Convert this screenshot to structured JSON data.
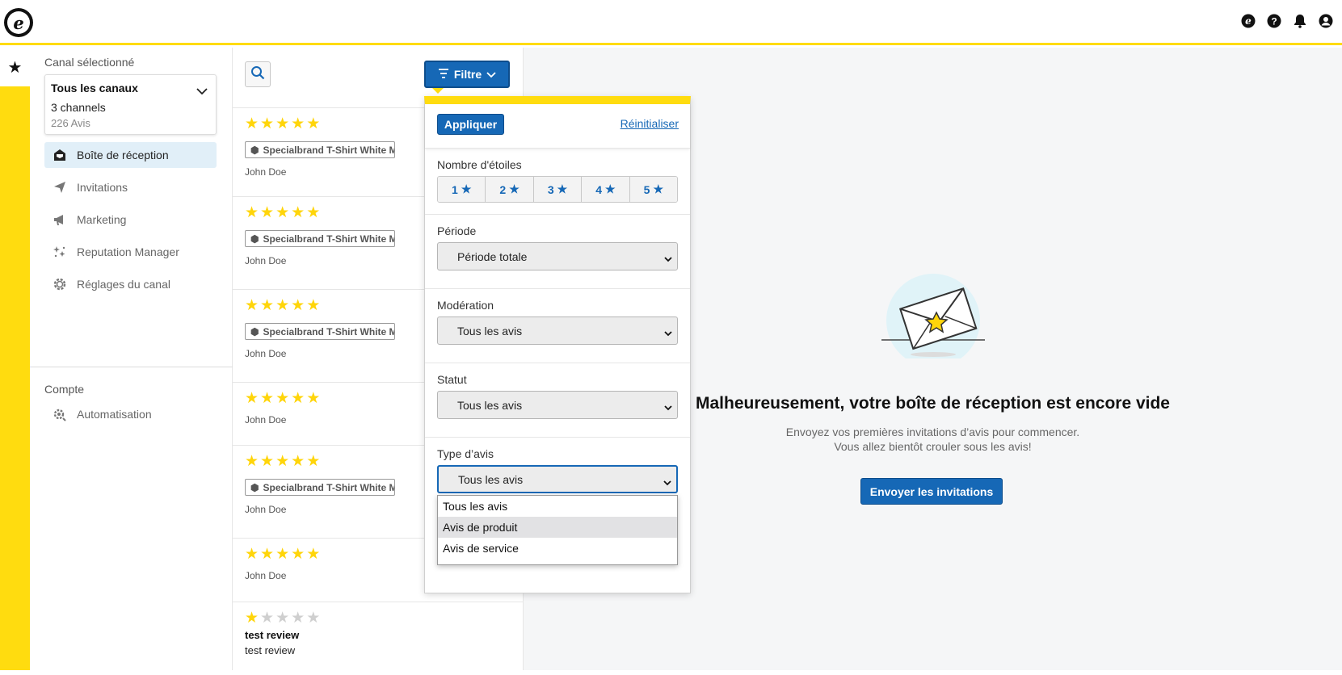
{
  "header": {
    "logo_letter": "e",
    "icons": [
      "trustedshops-icon",
      "help-icon",
      "bell-icon",
      "user-icon"
    ]
  },
  "colors": {
    "accent_yellow": "#ffdc0f",
    "primary_blue": "#1668b6",
    "star_yellow": "#ffd50a"
  },
  "sidebar": {
    "rail_icon": "★",
    "channel_label": "Canal sélectionné",
    "channel": {
      "title": "Tous les canaux",
      "count": "3 channels",
      "reviews": "226 Avis"
    },
    "nav": [
      {
        "label": "Boîte de réception",
        "icon": "inbox-icon"
      },
      {
        "label": "Invitations",
        "icon": "send-icon"
      },
      {
        "label": "Marketing",
        "icon": "megaphone-icon"
      },
      {
        "label": "Reputation Manager",
        "icon": "sparkles-icon"
      },
      {
        "label": "Réglages du canal",
        "icon": "gear-icon"
      }
    ],
    "account_label": "Compte",
    "account_nav": [
      {
        "label": "Automatisation",
        "icon": "automation-icon"
      }
    ]
  },
  "list": {
    "filter_label": "Filtre",
    "reviews": [
      {
        "rating": 5,
        "product": "Specialbrand T-Shirt White M",
        "author": "John Doe"
      },
      {
        "rating": 5,
        "product": "Specialbrand T-Shirt White M",
        "author": "John Doe"
      },
      {
        "rating": 5,
        "product": "Specialbrand T-Shirt White M",
        "author": "John Doe"
      },
      {
        "rating": 5,
        "product": "",
        "author": "John Doe"
      },
      {
        "rating": 5,
        "product": "Specialbrand T-Shirt White M",
        "author": "John Doe"
      },
      {
        "rating": 5,
        "product": "",
        "author": "John Doe"
      },
      {
        "rating": 1,
        "title": "test review",
        "text": "test review"
      }
    ]
  },
  "filter_panel": {
    "apply_label": "Appliquer",
    "reset_label": "Réinitialiser",
    "stars_label": "Nombre d'étoiles",
    "star_options": [
      "1",
      "2",
      "3",
      "4",
      "5"
    ],
    "period_label": "Période",
    "period_value": "Période totale",
    "moderation_label": "Modération",
    "moderation_value": "Tous les avis",
    "status_label": "Statut",
    "status_value": "Tous les avis",
    "type_label": "Type d’avis",
    "type_value": "Tous les avis",
    "type_options": [
      "Tous les avis",
      "Avis de produit",
      "Avis de service"
    ]
  },
  "empty_state": {
    "title": "Malheureusement, votre boîte de réception est encore vide",
    "line1": "Envoyez vos premières invitations d’avis pour commencer.",
    "line2": "Vous allez bientôt crouler sous les avis!",
    "button": "Envoyer les invitations"
  }
}
